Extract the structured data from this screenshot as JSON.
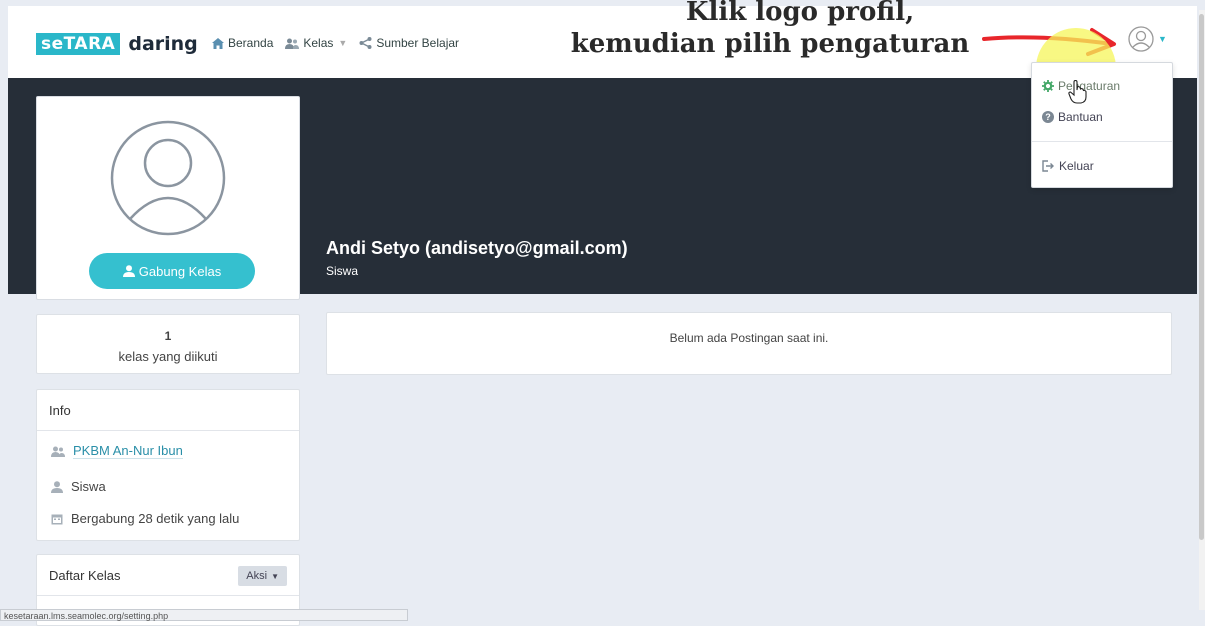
{
  "brand": {
    "logo_box": "seTARA",
    "logo_word": "daring"
  },
  "nav": {
    "beranda": "Beranda",
    "kelas": "Kelas",
    "sumber_belajar": "Sumber Belajar"
  },
  "annotation": {
    "line1": "Klik logo profil,",
    "line2": "kemudian pilih pengaturan"
  },
  "profile_menu": {
    "items": [
      {
        "label": "Pengaturan",
        "icon": "gear-icon"
      },
      {
        "label": "Bantuan",
        "icon": "question-circle-icon"
      },
      {
        "label": "Keluar",
        "icon": "sign-out-icon"
      }
    ]
  },
  "profile": {
    "join_button": "Gabung Kelas",
    "name": "Andi Setyo (andisetyo@gmail.com)",
    "role": "Siswa"
  },
  "stats": {
    "count": "1",
    "label": "kelas yang diikuti"
  },
  "posts": {
    "empty_message": "Belum ada Postingan saat ini."
  },
  "info": {
    "title": "Info",
    "org": "PKBM An-Nur Ibun",
    "role": "Siswa",
    "joined": "Bergabung 28 detik yang lalu"
  },
  "classes": {
    "title": "Daftar Kelas",
    "action": "Aksi"
  },
  "status_bar": {
    "url": "kesetaraan.lms.seamolec.org/setting.php"
  },
  "colors": {
    "accent": "#2ab7c9",
    "banner": "#262e38",
    "highlight": "#f6f55a",
    "arrow": "#e8262b",
    "background": "#e8ecf3"
  }
}
